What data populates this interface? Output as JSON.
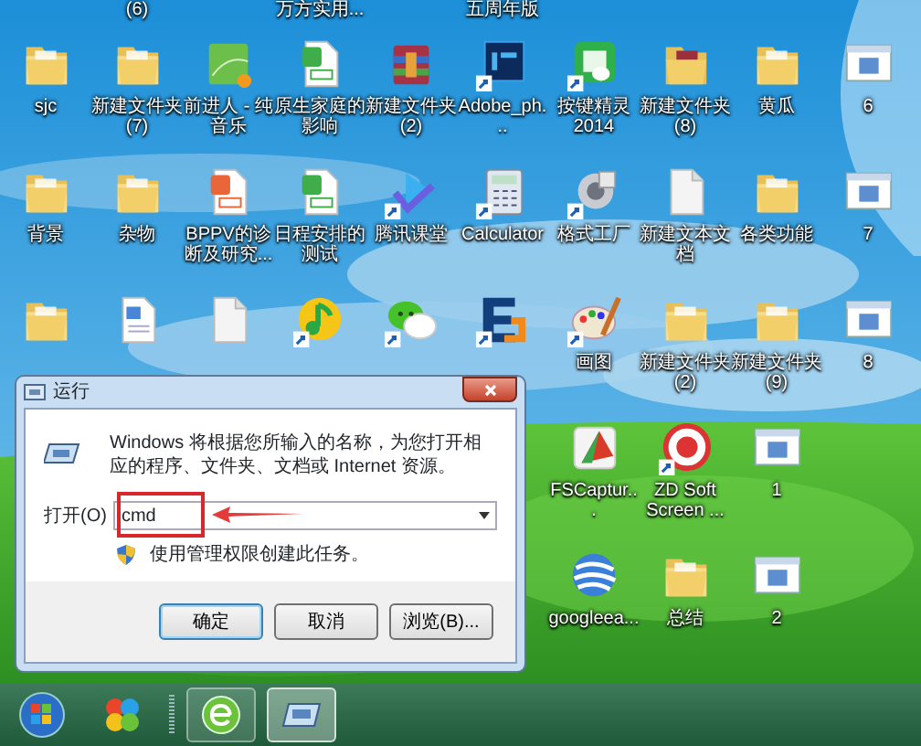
{
  "desktop": {
    "columns": [
      {
        "icons": [
          {
            "kind": "folder",
            "label": "sjc"
          },
          {
            "kind": "folder",
            "label": "背景"
          },
          {
            "kind": "folder"
          }
        ]
      },
      {
        "top_label": "(6)",
        "icons": [
          {
            "kind": "folder",
            "label": "新建文件夹 (7)"
          },
          {
            "kind": "folder",
            "label": "杂物"
          },
          {
            "kind": "word"
          }
        ]
      },
      {
        "icons": [
          {
            "kind": "music-book",
            "label": "前进人 - 纯音乐"
          },
          {
            "kind": "slide",
            "label": "BPPV的诊断及研究..."
          },
          {
            "kind": "blank"
          }
        ]
      },
      {
        "top_label": "万方实用...",
        "icons": [
          {
            "kind": "sheet",
            "label": "原生家庭的影响"
          },
          {
            "kind": "sheet",
            "label": "日程安排的测试"
          },
          {
            "kind": "music",
            "shortcut": true
          }
        ]
      },
      {
        "icons": [
          {
            "kind": "archive",
            "label": "新建文件夹 (2)"
          },
          {
            "kind": "play",
            "shortcut": true,
            "label": "腾讯课堂"
          },
          {
            "kind": "chat",
            "shortcut": true
          }
        ]
      },
      {
        "top_label": "五周年版",
        "icons": [
          {
            "kind": "ps",
            "shortcut": true,
            "label": "Adobe_ph..."
          },
          {
            "kind": "calc",
            "shortcut": true,
            "label": "Calculator"
          },
          {
            "kind": "e-app",
            "shortcut": true
          }
        ]
      },
      {
        "icons": [
          {
            "kind": "green-app",
            "shortcut": true,
            "label": "按键精灵 2014"
          },
          {
            "kind": "tool",
            "shortcut": true,
            "label": "格式工厂"
          },
          {
            "kind": "paint",
            "shortcut": true,
            "label": "画图"
          },
          {
            "kind": "capture",
            "label": "FSCaptur..."
          },
          {
            "kind": "globe",
            "label": "googleea..."
          }
        ]
      },
      {
        "icons": [
          {
            "kind": "archive-folder",
            "label": "新建文件夹 (8)"
          },
          {
            "kind": "blank",
            "label": "新建文本文档"
          },
          {
            "kind": "folder",
            "label": "新建文件夹 (2)"
          },
          {
            "kind": "record",
            "shortcut": true,
            "label": "ZD Soft Screen ..."
          },
          {
            "kind": "folder",
            "label": "总结"
          }
        ]
      },
      {
        "icons": [
          {
            "kind": "folder",
            "label": "黄瓜"
          },
          {
            "kind": "folder",
            "label": "各类功能"
          },
          {
            "kind": "folder",
            "label": "新建文件夹 (9)"
          },
          {
            "kind": "window",
            "label": "1"
          },
          {
            "kind": "window",
            "label": "2"
          }
        ]
      },
      {
        "icons": [
          {
            "kind": "window",
            "label": "6"
          },
          {
            "kind": "window",
            "label": "7"
          },
          {
            "kind": "window",
            "label": "8"
          }
        ]
      }
    ]
  },
  "run_dialog": {
    "title": "运行",
    "description": "Windows 将根据您所输入的名称，为您打开相应的程序、文件夹、文档或 Internet 资源。",
    "open_label": "打开(O)",
    "value": "cmd",
    "admin_note": "使用管理权限创建此任务。",
    "highlighted": true,
    "buttons": [
      {
        "label": "确定",
        "default": true
      },
      {
        "label": "取消",
        "default": false
      },
      {
        "label": "浏览(B)...",
        "default": false
      }
    ]
  },
  "taskbar": {
    "buttons": [
      {
        "kind": "start",
        "selected": false
      },
      {
        "kind": "colors",
        "selected": false
      },
      {
        "kind": "browser",
        "selected": false
      },
      {
        "kind": "run",
        "selected": true
      }
    ]
  }
}
